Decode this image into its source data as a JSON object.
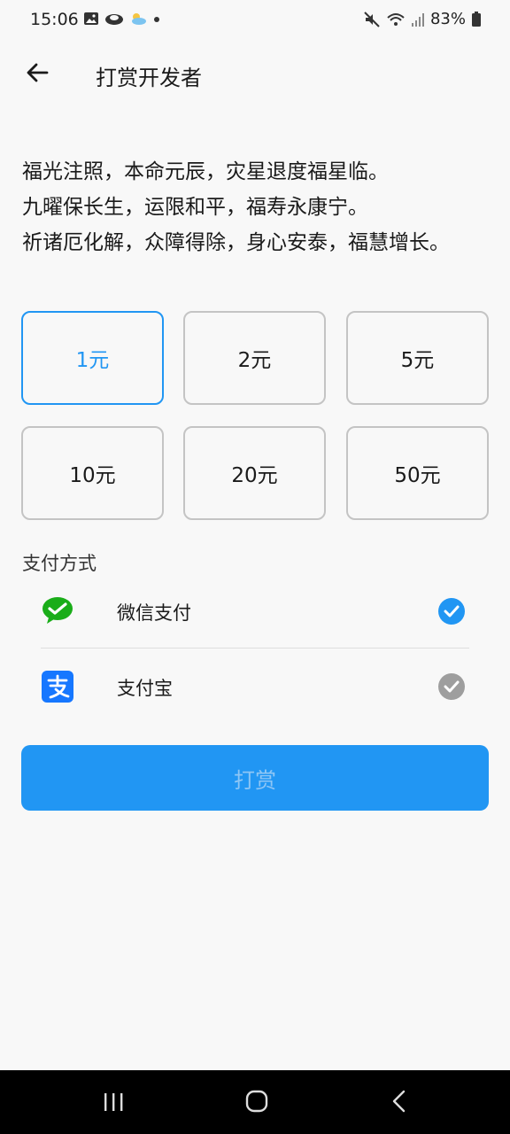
{
  "status_bar": {
    "time": "15:06",
    "battery": "83%"
  },
  "header": {
    "title": "打赏开发者"
  },
  "blessing": {
    "lines": [
      "福光注照，本命元辰，灾星退度福星临。",
      "九曜保长生，运限和平，福寿永康宁。",
      "祈诸厄化解，众障得除，身心安泰，福慧增长。"
    ]
  },
  "amounts": {
    "selected": "1元",
    "options": [
      "1元",
      "2元",
      "5元",
      "10元",
      "20元",
      "50元"
    ]
  },
  "payment": {
    "label": "支付方式",
    "methods": [
      {
        "name": "微信支付",
        "icon": "wechat-pay-icon",
        "checked": true,
        "check_color": "#2196f3"
      },
      {
        "name": "支付宝",
        "icon": "alipay-icon",
        "checked": false,
        "check_color": "#9e9e9e"
      }
    ]
  },
  "submit": {
    "label": "打赏"
  },
  "colors": {
    "accent": "#2196f3",
    "wechat": "#1aad19",
    "alipay": "#1677ff"
  }
}
